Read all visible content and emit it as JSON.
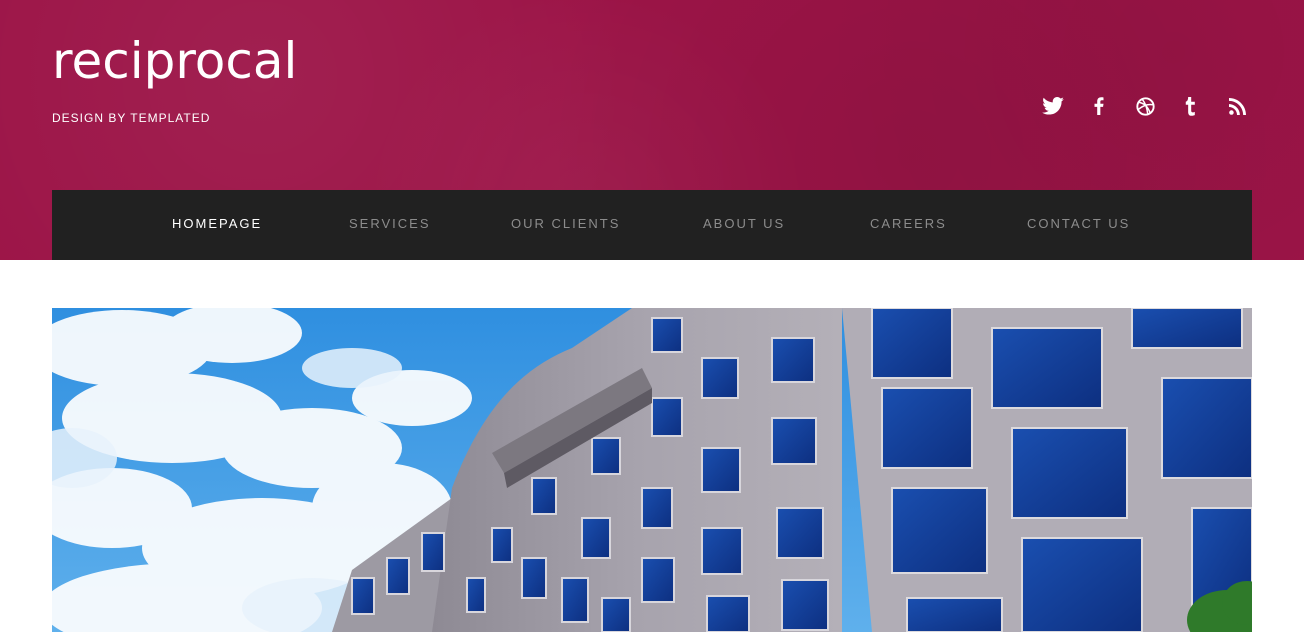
{
  "site": {
    "title": "reciprocal",
    "tagline": "DESIGN BY TEMPLATED"
  },
  "colors": {
    "header_bg": "#9c1447",
    "nav_bg": "#212121",
    "nav_active": "#ffffff",
    "nav_inactive": "#8c8c8c"
  },
  "social": [
    {
      "icon": "twitter-icon"
    },
    {
      "icon": "facebook-icon"
    },
    {
      "icon": "dribbble-icon"
    },
    {
      "icon": "tumblr-icon"
    },
    {
      "icon": "rss-icon"
    }
  ],
  "nav": {
    "items": [
      {
        "label": "HOMEPAGE",
        "active": true
      },
      {
        "label": "SERVICES",
        "active": false
      },
      {
        "label": "OUR CLIENTS",
        "active": false
      },
      {
        "label": "ABOUT US",
        "active": false
      },
      {
        "label": "CAREERS",
        "active": false
      },
      {
        "label": "CONTACT US",
        "active": false
      }
    ]
  },
  "banner": {
    "image": "office-building-photo"
  }
}
